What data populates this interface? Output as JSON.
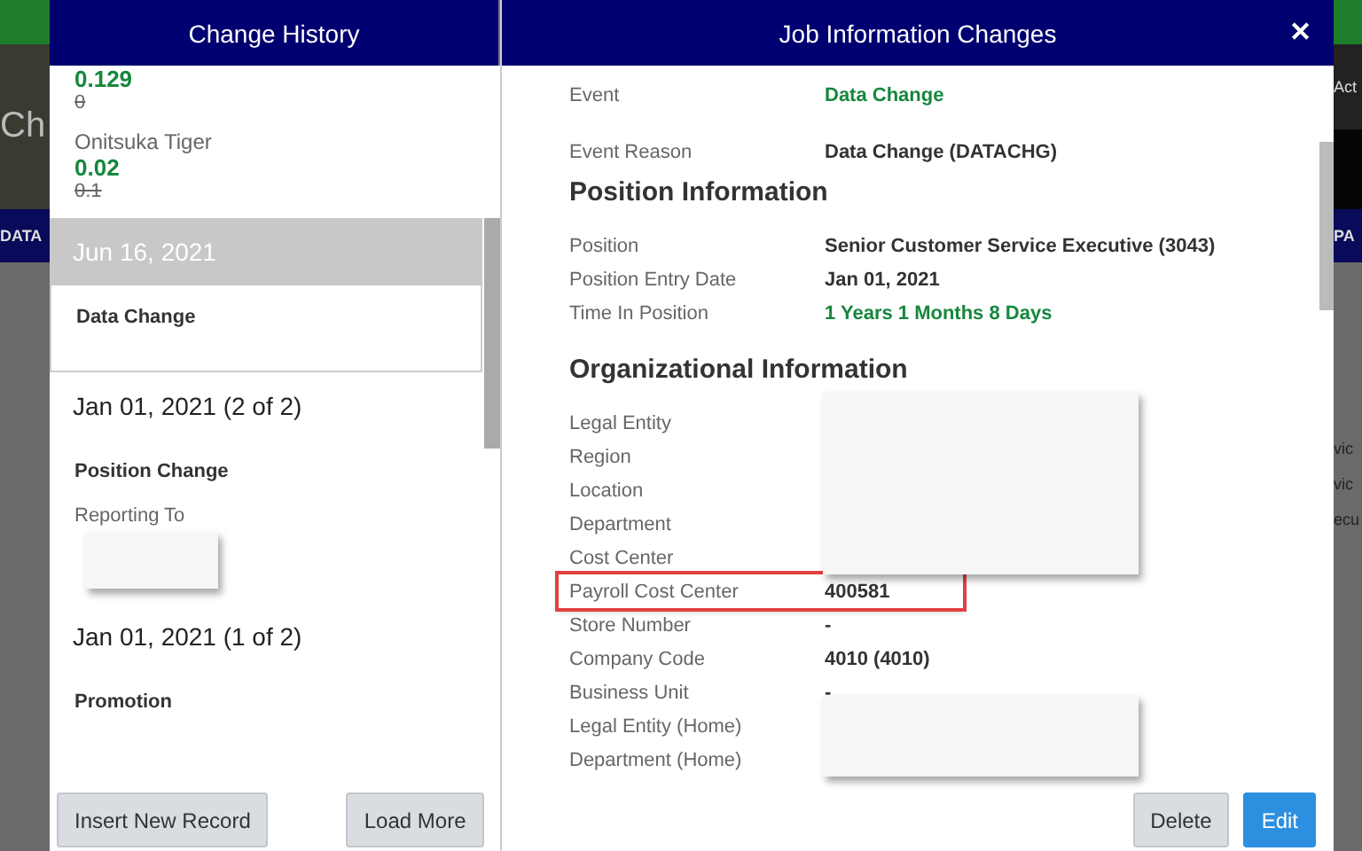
{
  "background": {
    "left_texts": [
      "Ch",
      "DATA"
    ],
    "right_texts": [
      "Act",
      "PA",
      "vic",
      "vic",
      "ecu"
    ]
  },
  "history_panel": {
    "title": "Change History",
    "items": [
      {
        "kind": "change",
        "new": "0.129",
        "old": "0"
      },
      {
        "kind": "change",
        "label": "Onitsuka Tiger",
        "new": "0.02",
        "old": "0.1"
      },
      {
        "kind": "date",
        "text": "Jun 16, 2021",
        "selected": true
      },
      {
        "kind": "event",
        "text": "Data Change",
        "selected": true
      },
      {
        "kind": "date",
        "text": "Jan 01, 2021 (2 of 2)",
        "selected": false
      },
      {
        "kind": "event",
        "text": "Position Change",
        "selected": false
      },
      {
        "kind": "redacted_change",
        "label": "Reporting To"
      },
      {
        "kind": "date",
        "text": "Jan 01, 2021 (1 of 2)",
        "selected": false
      },
      {
        "kind": "event",
        "text": "Promotion",
        "selected": false
      }
    ],
    "buttons": [
      "Insert New Record",
      "Load More"
    ]
  },
  "details_panel": {
    "title": "Job Information Changes",
    "close": "✕",
    "sections": [
      {
        "fields": [
          {
            "kind": "positive",
            "label": "Event",
            "value": "Data Change"
          },
          {
            "kind": "plain",
            "label": "Event Reason",
            "value": "Data Change (DATACHG)"
          }
        ]
      },
      {
        "heading": "Position Information",
        "fields": [
          {
            "kind": "plain",
            "label": "Position",
            "value": "Senior Customer Service Executive (3043)"
          },
          {
            "kind": "plain",
            "label": "Position Entry Date",
            "value": "Jan 01, 2021"
          },
          {
            "kind": "positive",
            "label": "Time In Position",
            "value": "1 Years 1 Months 8 Days"
          }
        ]
      },
      {
        "heading": "Organizational Information",
        "fields": [
          {
            "kind": "redacted",
            "label": "Legal Entity"
          },
          {
            "kind": "redacted",
            "label": "Region"
          },
          {
            "kind": "redacted",
            "label": "Location"
          },
          {
            "kind": "redacted",
            "label": "Department"
          },
          {
            "kind": "redacted",
            "label": "Cost Center"
          },
          {
            "kind": "highlighted",
            "label": "Payroll Cost Center",
            "value": "400581"
          },
          {
            "kind": "plain",
            "label": "Store Number",
            "value": "-"
          },
          {
            "kind": "plain",
            "label": "Company Code",
            "value": "4010 (4010)"
          },
          {
            "kind": "plain",
            "label": "Business Unit",
            "value": "-"
          },
          {
            "kind": "redacted",
            "label": "Legal Entity (Home)"
          },
          {
            "kind": "redacted",
            "label": "Department (Home)"
          }
        ]
      }
    ],
    "buttons": [
      {
        "label": "Delete",
        "primary": false
      },
      {
        "label": "Edit",
        "primary": true
      }
    ]
  }
}
